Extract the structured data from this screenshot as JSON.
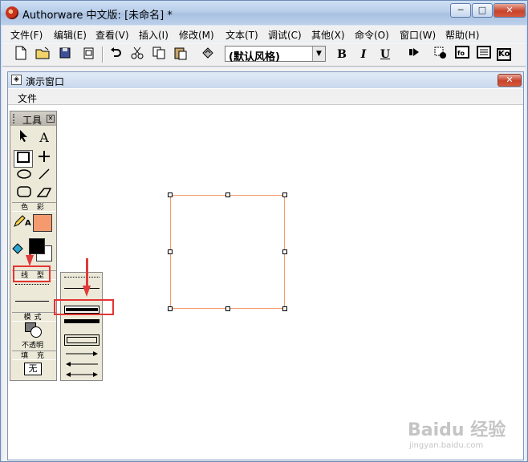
{
  "window": {
    "title": "Authorware 中文版: [未命名] *",
    "minimize_glyph": "─",
    "maximize_glyph": "□",
    "close_glyph": "✕"
  },
  "menubar": {
    "items": [
      "文件(F)",
      "编辑(E)",
      "查看(V)",
      "插入(I)",
      "修改(M)",
      "文本(T)",
      "调试(C)",
      "其他(X)",
      "命令(O)",
      "窗口(W)",
      "帮助(H)"
    ]
  },
  "toolbar": {
    "style_selected": "(默认风格)",
    "bold_label": "B",
    "italic_label": "I",
    "underline_label": "U",
    "fn_label": "fo",
    "ko_label": "Ko"
  },
  "presentation_window": {
    "title": "演示窗口",
    "close_glyph": "✕",
    "menu_file": "文件"
  },
  "tools_palette": {
    "title": "工具",
    "text_tool_label": "A",
    "color_section": "色 彩",
    "pencil_text_label": "A",
    "line_section": "线 型",
    "mode_section": "模式",
    "mode_value": "不透明",
    "fill_section": "填 充",
    "fill_value": "无"
  },
  "colors": {
    "fill_swatch": "#f49a6e",
    "shape_border": "#f29a6a",
    "foreground": "#000000",
    "background": "#ffffff",
    "highlight": "#e53535"
  },
  "watermark": {
    "main": "Baidu 经验",
    "sub": "jingyan.baidu.com"
  }
}
